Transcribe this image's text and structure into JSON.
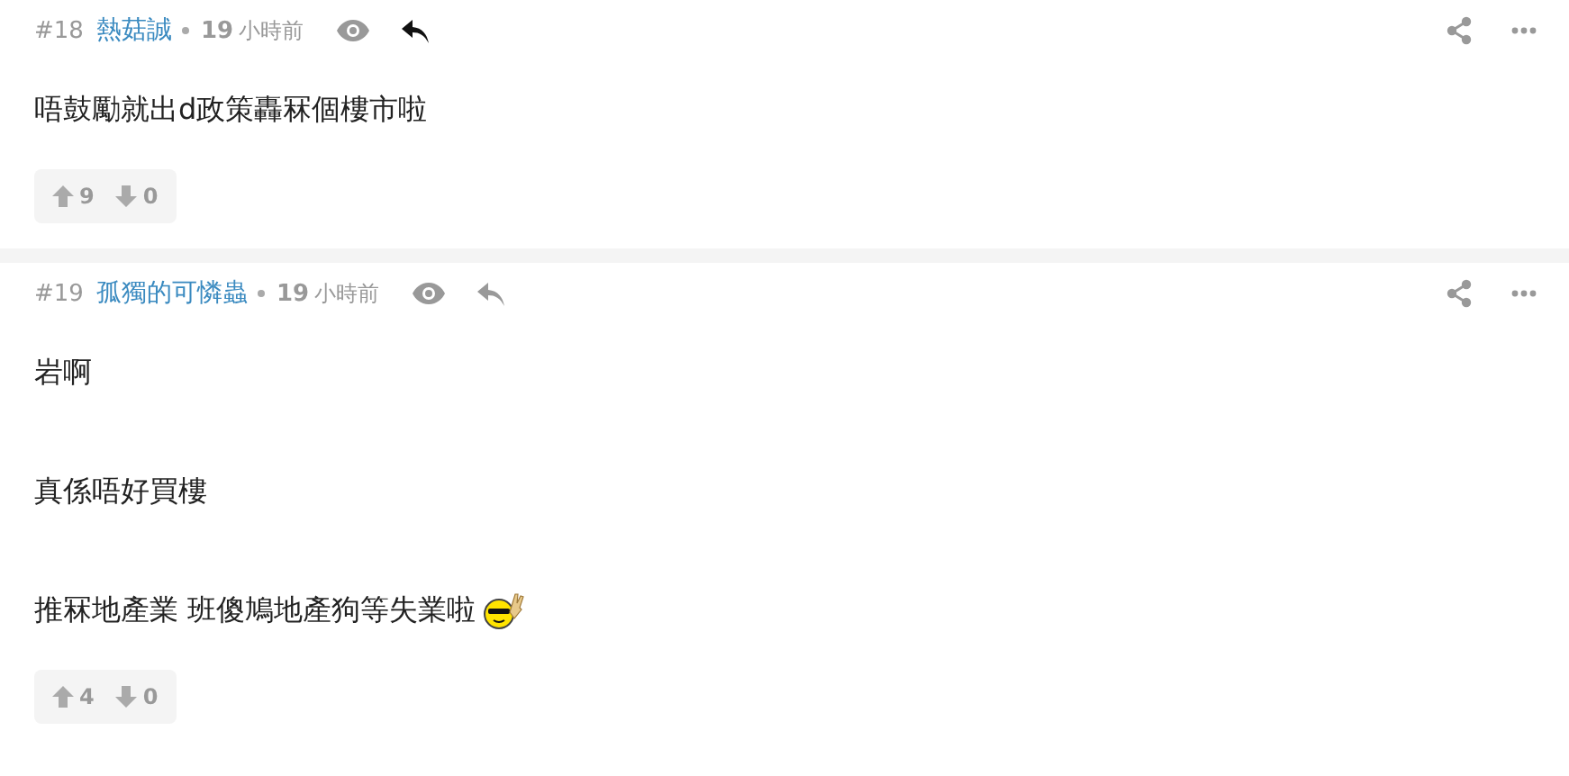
{
  "posts": [
    {
      "number": "#18",
      "author": "熱菇誠",
      "time_value": "19",
      "time_unit": "小時前",
      "reply_active": true,
      "lines": [
        {
          "text": "唔鼓勵就出d政策轟冧個樓市啦"
        }
      ],
      "upvotes": "9",
      "downvotes": "0"
    },
    {
      "number": "#19",
      "author": "孤獨的可憐蟲",
      "time_value": "19",
      "time_unit": "小時前",
      "reply_active": false,
      "lines": [
        {
          "text": "岩啊"
        },
        {
          "text": "真係唔好買樓"
        },
        {
          "text": "推冧地產業 班傻鳩地產狗等失業啦",
          "emoji": true
        }
      ],
      "upvotes": "4",
      "downvotes": "0"
    }
  ]
}
